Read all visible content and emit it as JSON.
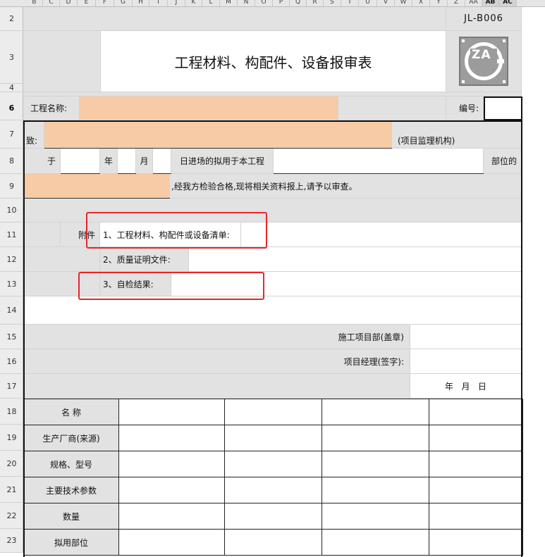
{
  "columns": [
    "B",
    "C",
    "D",
    "E",
    "F",
    "G",
    "H",
    "I",
    "J",
    "K",
    "L",
    "M",
    "N",
    "O",
    "P",
    "Q",
    "R",
    "S",
    "T",
    "U",
    "V",
    "W",
    "X",
    "Y",
    "Z",
    "AA",
    "AB",
    "AC"
  ],
  "rows": [
    "2",
    "3",
    "4",
    "6",
    "7",
    "8",
    "9",
    "10",
    "11",
    "12",
    "13",
    "14",
    "15",
    "16",
    "17",
    "18",
    "19",
    "20",
    "21",
    "22",
    "23"
  ],
  "form": {
    "code": "JL-B006",
    "title": "工程材料、构配件、设备报审表",
    "logo_text": "ZA",
    "project_name_label": "工程名称:",
    "number_label": "编号:",
    "to_label": "致:",
    "supervisor_org": "(项目监理机构)",
    "yu": "于",
    "year": "年",
    "month": "月",
    "entered_text": "日进场的拟用于本工程",
    "position_text": "部位的",
    "inspected_text": ",经我方检验合格,现将相关资料报上,请予以审查。",
    "attachment_label": "附件",
    "attach1": "1、工程材料、构配件或设备清单:",
    "attach2": "2、质量证明文件:",
    "attach3": "3、自检结果:",
    "dept_label": "施工项目部(盖章)",
    "manager_label": "项目经理(签字):",
    "date_label": "年   月   日"
  },
  "table": {
    "row_labels": [
      "名 称",
      "生产厂商(来源)",
      "规格、型号",
      "主要技术参数",
      "数量",
      "拟用部位"
    ]
  }
}
